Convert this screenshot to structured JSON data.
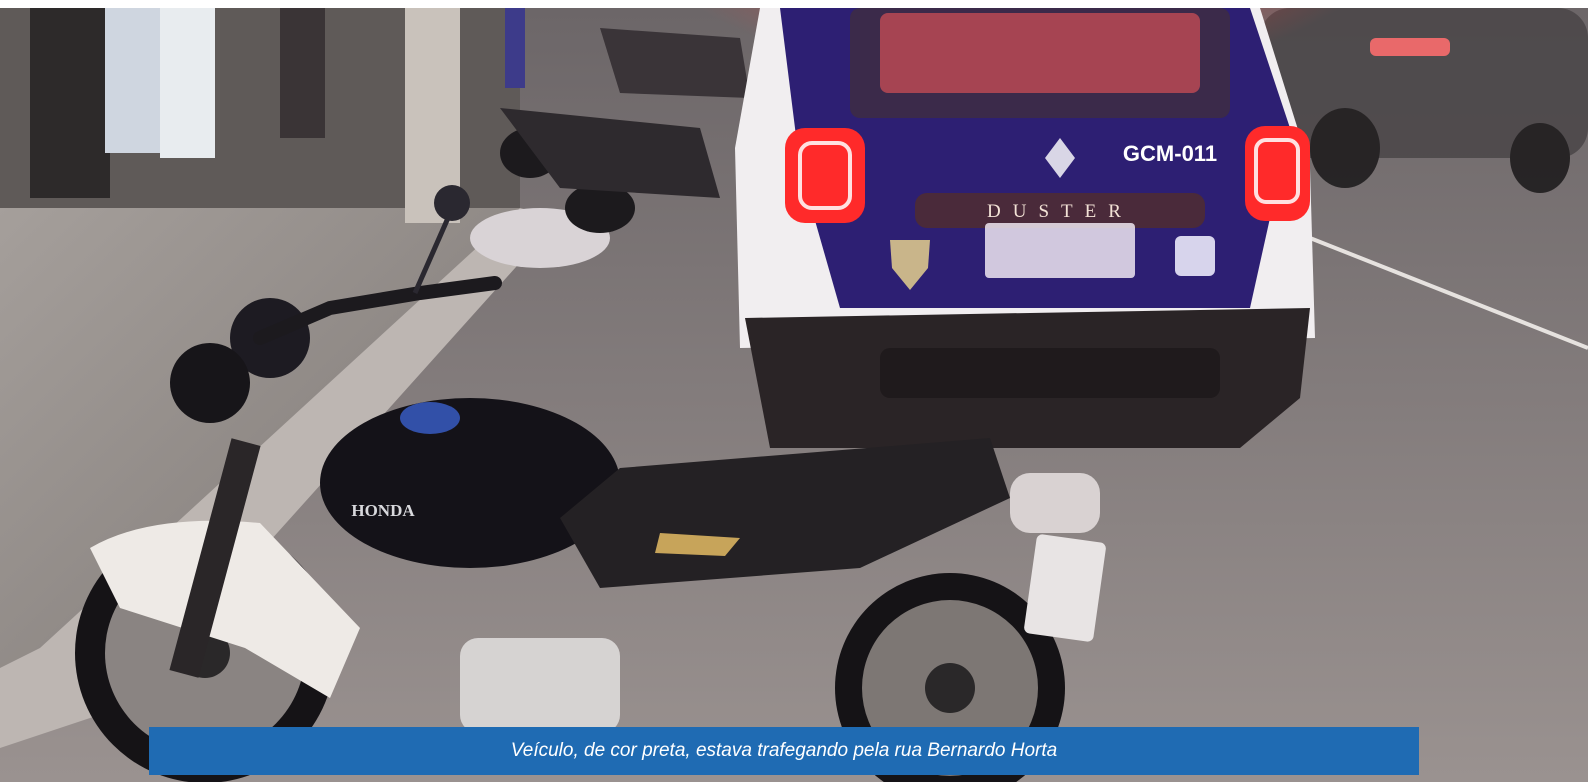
{
  "caption": "Veículo, de cor preta, estava trafegando pela rua Bernardo Horta",
  "vehicle_text": {
    "brand": "HONDA",
    "unit": "GCM-011",
    "model": "DUSTER"
  },
  "colors": {
    "caption_bar": "#1f6bb3",
    "caption_text": "#ffffff",
    "car_body": "#2d1f73",
    "car_white": "#f1eef0",
    "taillight": "#ff2a2a",
    "motorcycle": "#141218",
    "pavement": "#8c8684"
  }
}
